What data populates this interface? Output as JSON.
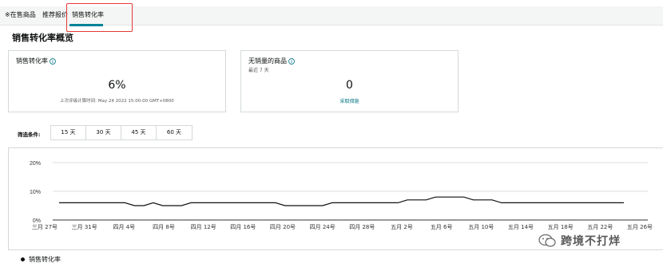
{
  "tabs": [
    {
      "label": "※在售商品"
    },
    {
      "label": "推荐报价"
    },
    {
      "label": "销售转化率"
    }
  ],
  "page_title": "销售转化率概览",
  "card_conversion": {
    "title": "销售转化率",
    "value": "6%",
    "note": "上次评级计算时间: May 24 2022 15:00:00 GMT+0800"
  },
  "card_no_sales": {
    "title": "无销量的商品",
    "subtitle": "最近 7 天",
    "value": "0",
    "link": "采取措施"
  },
  "filter": {
    "label": "筛选条件:",
    "options": [
      "15 天",
      "30 天",
      "45 天",
      "60 天"
    ]
  },
  "legend": {
    "series_name": "销售转化率"
  },
  "watermark": {
    "text": "跨境不打烊"
  },
  "colors": {
    "accent": "#008296",
    "line": "#0f1111",
    "highlight": "#e53935"
  },
  "chart_data": {
    "type": "line",
    "y_ticks": [
      "20%",
      "10%",
      "0%"
    ],
    "ylim": [
      0,
      20
    ],
    "x_ticks": [
      "三月 27号",
      "三月 31号",
      "四月 4号",
      "四月 8号",
      "四月 12号",
      "四月 16号",
      "四月 20号",
      "四月 24号",
      "四月 28号",
      "五月 2号",
      "五月 6号",
      "五月 10号",
      "五月 14号",
      "五月 18号",
      "五月 22号",
      "五月 26号"
    ],
    "series": [
      {
        "name": "销售转化率",
        "x": [
          "3/27",
          "3/28",
          "3/29",
          "3/30",
          "3/31",
          "4/1",
          "4/2",
          "4/3",
          "4/4",
          "4/5",
          "4/6",
          "4/7",
          "4/8",
          "4/9",
          "4/10",
          "4/11",
          "4/12",
          "4/13",
          "4/14",
          "4/15",
          "4/16",
          "4/17",
          "4/18",
          "4/19",
          "4/20",
          "4/21",
          "4/22",
          "4/23",
          "4/24",
          "4/25",
          "4/26",
          "4/27",
          "4/28",
          "4/29",
          "4/30",
          "5/1",
          "5/2",
          "5/3",
          "5/4",
          "5/5",
          "5/6",
          "5/7",
          "5/8",
          "5/9",
          "5/10",
          "5/11",
          "5/12",
          "5/13",
          "5/14",
          "5/15",
          "5/16",
          "5/17",
          "5/18",
          "5/19",
          "5/20",
          "5/21",
          "5/22",
          "5/23",
          "5/24",
          "5/25",
          "5/26"
        ],
        "values": [
          6,
          6,
          6,
          6,
          6,
          6,
          6,
          6,
          5,
          5,
          6,
          5,
          5,
          5,
          6,
          6,
          6,
          6,
          6,
          6,
          6,
          6,
          6,
          6,
          5,
          5,
          5,
          5,
          5,
          6,
          6,
          6,
          6,
          6,
          6,
          6,
          6,
          7,
          7,
          7,
          8,
          8,
          8,
          8,
          7,
          7,
          7,
          6,
          6,
          6,
          6,
          6,
          6,
          6,
          6,
          6,
          6,
          6,
          6,
          6,
          6
        ]
      }
    ]
  }
}
